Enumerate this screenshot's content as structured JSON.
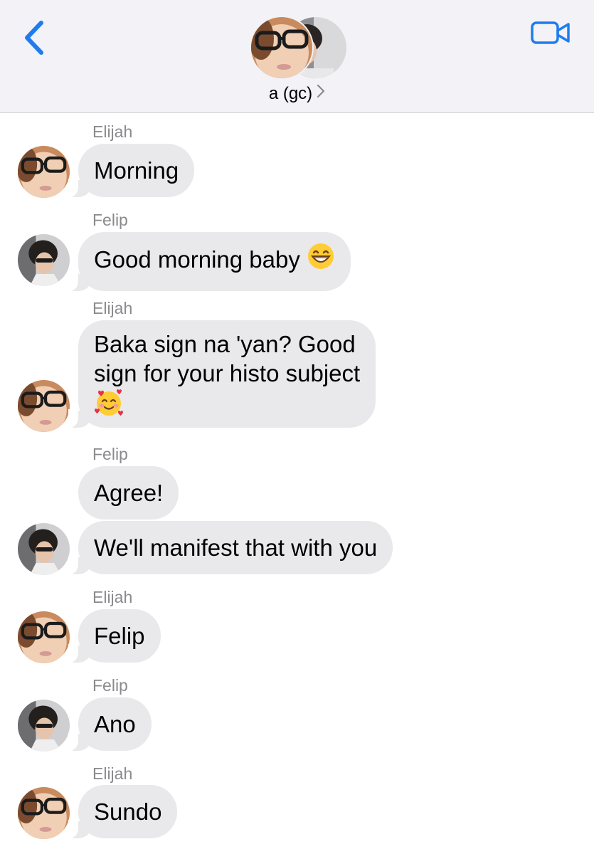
{
  "header": {
    "title": "a (gc)",
    "back_icon": "chevron-left-icon",
    "video_icon": "video-camera-icon",
    "accent": "#1f7cf0"
  },
  "colors": {
    "bubble": "#e9e9eb",
    "sender_label": "#8a8a8e",
    "header_bg": "#f2f2f7"
  },
  "messages": [
    {
      "sender": "Elijah",
      "text": "Morning"
    },
    {
      "sender": "Felip",
      "text": "Good morning baby",
      "emoji": "grinning-face-icon"
    },
    {
      "sender": "Elijah",
      "text_lines": [
        "Baka sign na 'yan? Good",
        "sign for your histo subject"
      ],
      "emoji": "smiling-face-with-hearts-icon"
    },
    {
      "sender": "Felip",
      "text": "Agree!"
    },
    {
      "sender": "",
      "text": "We'll manifest that with you"
    },
    {
      "sender": "Elijah",
      "text": "Felip"
    },
    {
      "sender": "Felip",
      "text": "Ano"
    },
    {
      "sender": "Elijah",
      "text": "Sundo"
    }
  ]
}
